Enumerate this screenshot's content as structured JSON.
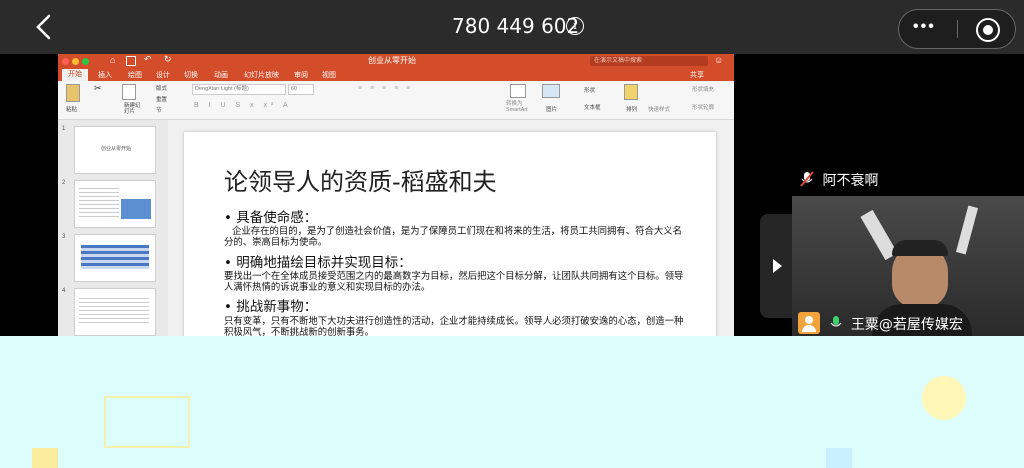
{
  "topbar": {
    "meeting_id": "780 449 602",
    "info_glyph": "i",
    "more_label": "•••"
  },
  "ppt": {
    "window_title": "创业从零开始",
    "search_placeholder": "在演示文稿中搜索",
    "tabs": [
      "开始",
      "插入",
      "绘图",
      "设计",
      "切换",
      "动画",
      "幻灯片放映",
      "审阅",
      "视图"
    ],
    "share_label": "共享",
    "ribbon": {
      "paste": "粘贴",
      "new_slide": "新建幻灯片",
      "layout": "版式",
      "reset": "重置",
      "section": "节",
      "font_name": "DengXian Light (标题)",
      "font_size": "60",
      "convert_smartart": "转换为 SmartArt",
      "picture": "图片",
      "shapes": "形状",
      "textbox": "文本框",
      "arrange": "排列",
      "quick_styles": "快速样式",
      "shape_fill": "形状填充",
      "shape_outline": "形状轮廓"
    },
    "thumbs": [
      {
        "num": "1",
        "text": "创业从零开始"
      },
      {
        "num": "2",
        "text": ""
      },
      {
        "num": "3",
        "text": ""
      },
      {
        "num": "4",
        "text": ""
      }
    ],
    "slide": {
      "title": "论领导人的资质-稻盛和夫",
      "sections": [
        {
          "heading": "• 具备使命感：",
          "body": "企业存在的目的，是为了创造社会价值，是为了保障员工们现在和将来的生活，将员工共同拥有、符合大义名分的、崇高目标为使命。"
        },
        {
          "heading": "• 明确地描绘目标并实现目标：",
          "body": "要找出一个在全体成员接受范围之内的最高数字为目标，然后把这个目标分解，让团队共同拥有这个目标。领导人满怀热情的诉说事业的意义和实现目标的办法。"
        },
        {
          "heading": "• 挑战新事物：",
          "body": "只有变革，只有不断地下大功夫进行创造性的活动，企业才能持续成长。领导人必须打破安逸的心态，创造一种积极风气，不断挑战新的创新事务。"
        }
      ]
    }
  },
  "participants": {
    "speaker_name": "阿不衰啊",
    "video_name": "王粟@若屋传媒宏"
  },
  "colors": {
    "ppt_accent": "#d34d2a",
    "cyan_bg": "#dcfdfb",
    "topbar_bg": "#2b2b2b"
  }
}
